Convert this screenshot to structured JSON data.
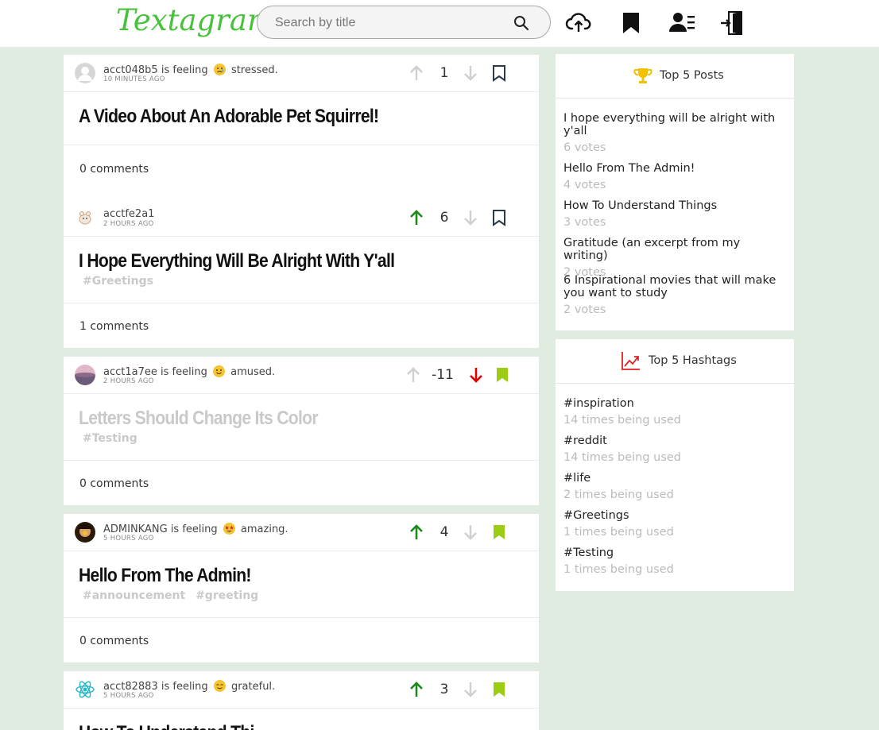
{
  "app": {
    "logo": "Textagram"
  },
  "search": {
    "placeholder": "Search by title"
  },
  "header_icons": [
    "upload-cloud-icon",
    "bookmark-icon",
    "profile-icon",
    "logout-icon"
  ],
  "colors": {
    "brand": "#48c13b",
    "upvote": "#1b8a1b",
    "downvote": "#e00000",
    "bookmark_filled": "#9acd14",
    "background": "#e0ece2"
  },
  "posts": [
    {
      "author": "acct048b5",
      "feeling_text": "is feeling",
      "feeling": "stressed.",
      "emoji": "sad-face",
      "time": "10 MINUTES AGO",
      "score": "1",
      "vote_state": "none",
      "bookmarked": false,
      "title": "A Video About An Adorable Pet Squirrel!",
      "faded": false,
      "tags": [],
      "comments": "0 comments"
    },
    {
      "author": "acctfe2a1",
      "feeling_text": "",
      "feeling": "",
      "emoji": "",
      "time": "2 HOURS AGO",
      "score": "6",
      "vote_state": "up",
      "bookmarked": false,
      "title": "I Hope Everything Will Be Alright With Y'all",
      "faded": false,
      "tags": [
        "#Greetings"
      ],
      "comments": "1 comments"
    },
    {
      "author": "acct1a7ee",
      "feeling_text": "is feeling",
      "feeling": "amused.",
      "emoji": "smile-face",
      "time": "2 HOURS AGO",
      "score": "-11",
      "vote_state": "down",
      "bookmarked": true,
      "title": "Letters Should Change Its Color",
      "faded": true,
      "tags": [
        "#Testing"
      ],
      "comments": "0 comments"
    },
    {
      "author": "ADMINKANG",
      "feeling_text": "is feeling",
      "feeling": "amazing.",
      "emoji": "star-eyes-face",
      "time": "5 HOURS AGO",
      "score": "4",
      "vote_state": "up",
      "bookmarked": true,
      "title": "Hello From The Admin!",
      "faded": false,
      "tags": [
        "#announcement",
        "#greeting"
      ],
      "comments": "0 comments"
    },
    {
      "author": "acct82883",
      "feeling_text": "is feeling",
      "feeling": "grateful.",
      "emoji": "blush-face",
      "time": "5 HOURS AGO",
      "score": "3",
      "vote_state": "up",
      "bookmarked": true,
      "title": "How To Understand Thi",
      "faded": false,
      "tags": [],
      "comments": ""
    }
  ],
  "top_posts": {
    "title": "Top 5 Posts",
    "items": [
      {
        "label": "I hope everything will be alright with y'all",
        "votes": "6 votes"
      },
      {
        "label": "Hello From The Admin!",
        "votes": "4 votes"
      },
      {
        "label": "How To Understand Things",
        "votes": "3 votes"
      },
      {
        "label": "Gratitude (an excerpt from my writing)",
        "votes": "2 votes"
      },
      {
        "label": "6 Inspirational movies that will make you want to study",
        "votes": "2 votes"
      }
    ]
  },
  "top_hashtags": {
    "title": "Top 5 Hashtags",
    "items": [
      {
        "label": "#inspiration",
        "count": "14 times being used"
      },
      {
        "label": "#reddit",
        "count": "14 times being used"
      },
      {
        "label": "#life",
        "count": "2 times being used"
      },
      {
        "label": "#Greetings",
        "count": "1 times being used"
      },
      {
        "label": "#Testing",
        "count": "1 times being used"
      }
    ]
  }
}
